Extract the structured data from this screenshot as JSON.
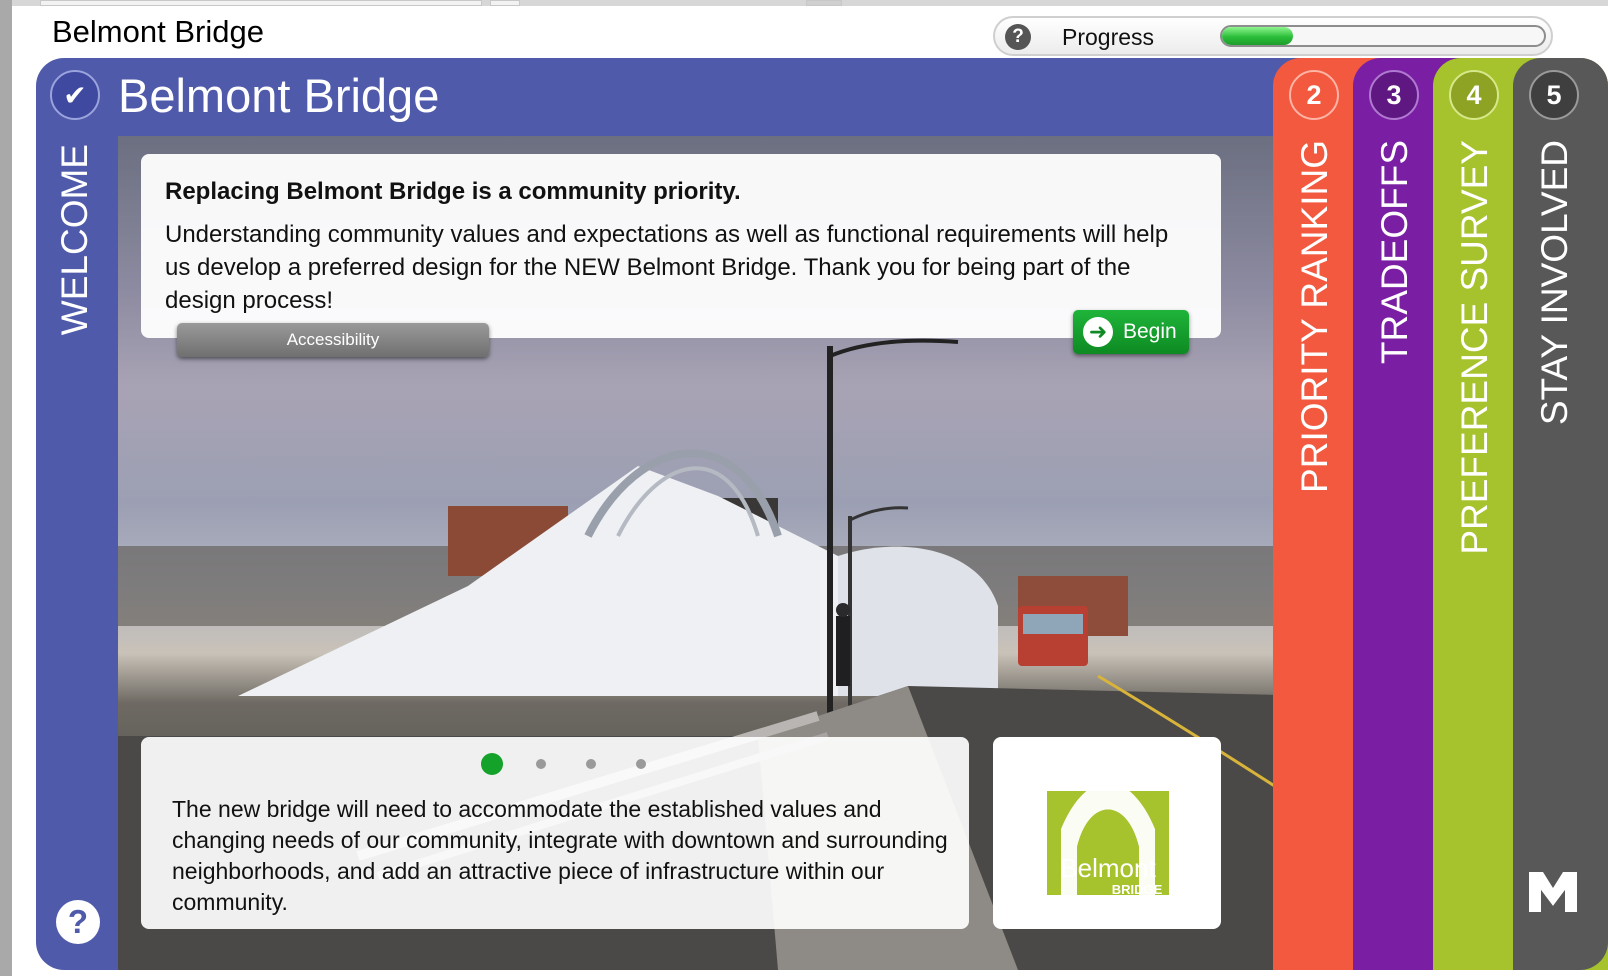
{
  "app": {
    "title": "Belmont Bridge"
  },
  "progress": {
    "label": "Progress",
    "value_fraction": 0.22,
    "help_icon": "help-circle-icon"
  },
  "welcome": {
    "header_title": "Belmont Bridge",
    "tab_label": "WELCOME",
    "intro_heading": "Replacing Belmont Bridge is a community priority.",
    "intro_body": "Understanding community values and expectations as well as functional requirements will help us develop a preferred design for the NEW Belmont Bridge. Thank you for being part of the design process!",
    "accessibility_label": "Accessibility",
    "begin_label": "Begin",
    "slide_text": "The new bridge will need to accommodate the established values and changing needs of our community, integrate with downtown and surrounding neighborhoods, and add an attractive piece of infrastructure within our community.",
    "slides": {
      "count": 4,
      "active": 1
    }
  },
  "logo": {
    "line1": "Belmont",
    "line2": "BRIDGE",
    "color": "#a6c22c"
  },
  "tabs": [
    {
      "num": "2",
      "label": "PRIORITY RANKING",
      "color": "#f2593f"
    },
    {
      "num": "3",
      "label": "TRADEOFFS",
      "color": "#7a1fa3"
    },
    {
      "num": "4",
      "label": "PREFERENCE SURVEY",
      "color": "#a6c22c"
    },
    {
      "num": "5",
      "label": "STAY INVOLVED",
      "color": "#585858"
    }
  ],
  "colors": {
    "welcome": "#4f5aab",
    "begin": "#15a22a",
    "progress_fill": "#2bbf3a"
  }
}
